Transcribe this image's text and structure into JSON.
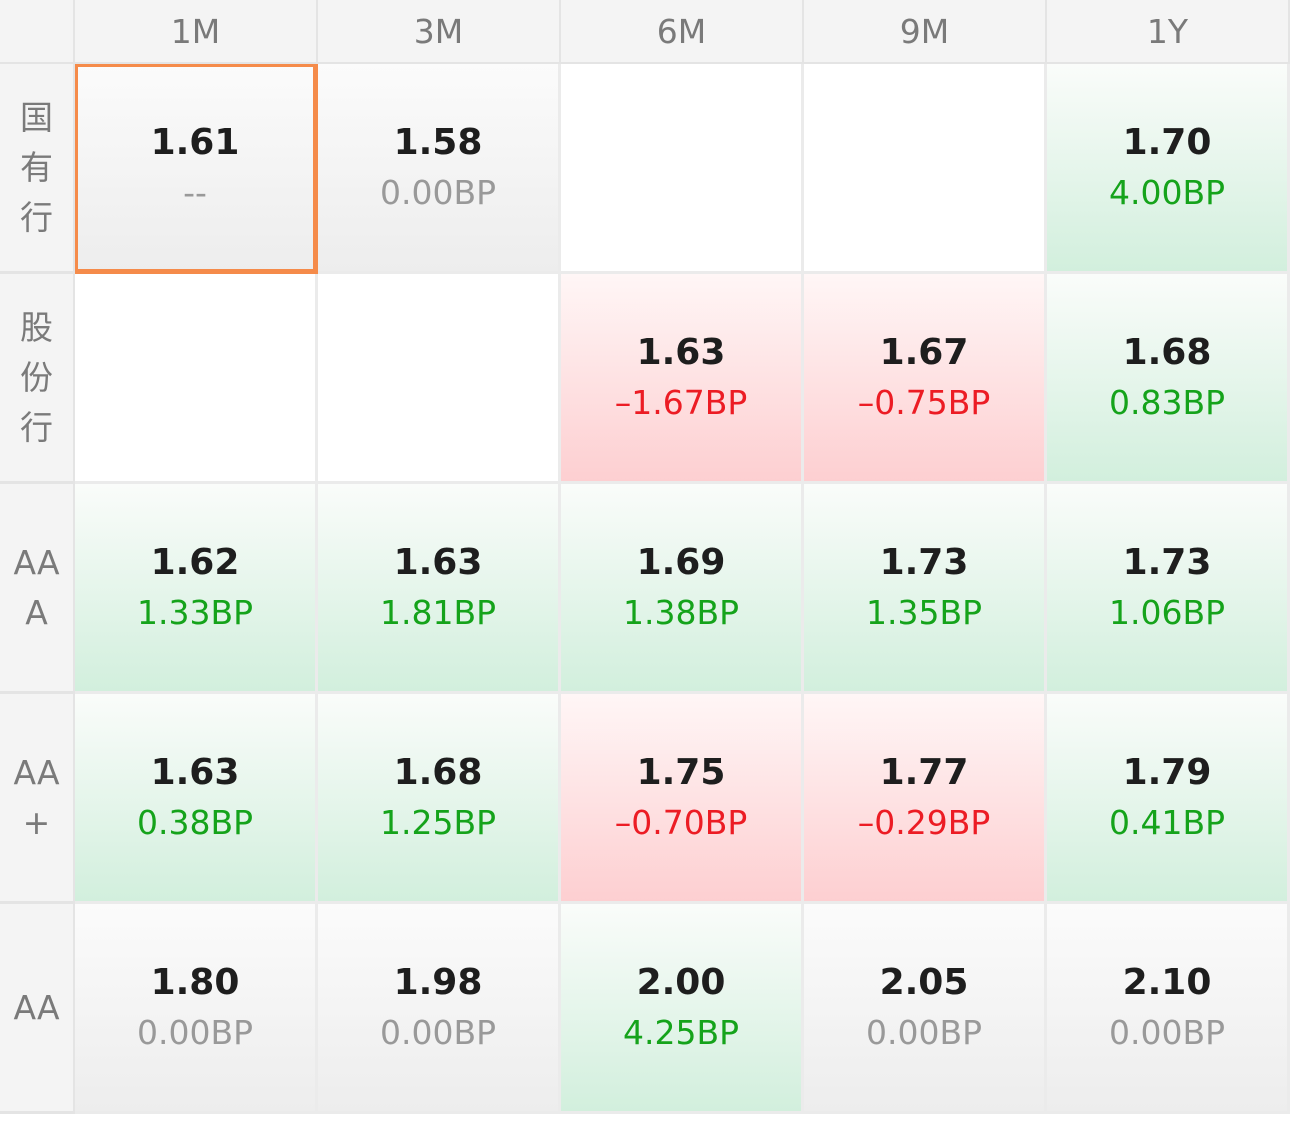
{
  "columns": [
    "1M",
    "3M",
    "6M",
    "9M",
    "1Y"
  ],
  "rows": [
    {
      "label": "国有行",
      "cells": [
        {
          "value": "1.61",
          "change": "--",
          "tone": "neutral",
          "selected": true
        },
        {
          "value": "1.58",
          "change": "0.00BP",
          "tone": "neutral"
        },
        {
          "value": "",
          "change": "",
          "tone": "empty"
        },
        {
          "value": "",
          "change": "",
          "tone": "empty"
        },
        {
          "value": "1.70",
          "change": "4.00BP",
          "tone": "green"
        }
      ]
    },
    {
      "label": "股份行",
      "cells": [
        {
          "value": "",
          "change": "",
          "tone": "empty"
        },
        {
          "value": "",
          "change": "",
          "tone": "empty"
        },
        {
          "value": "1.63",
          "change": "–1.67BP",
          "tone": "red"
        },
        {
          "value": "1.67",
          "change": "–0.75BP",
          "tone": "red"
        },
        {
          "value": "1.68",
          "change": "0.83BP",
          "tone": "green"
        }
      ]
    },
    {
      "label": "AAA",
      "cells": [
        {
          "value": "1.62",
          "change": "1.33BP",
          "tone": "green"
        },
        {
          "value": "1.63",
          "change": "1.81BP",
          "tone": "green"
        },
        {
          "value": "1.69",
          "change": "1.38BP",
          "tone": "green"
        },
        {
          "value": "1.73",
          "change": "1.35BP",
          "tone": "green"
        },
        {
          "value": "1.73",
          "change": "1.06BP",
          "tone": "green"
        }
      ]
    },
    {
      "label": "AA+",
      "cells": [
        {
          "value": "1.63",
          "change": "0.38BP",
          "tone": "green"
        },
        {
          "value": "1.68",
          "change": "1.25BP",
          "tone": "green"
        },
        {
          "value": "1.75",
          "change": "–0.70BP",
          "tone": "red"
        },
        {
          "value": "1.77",
          "change": "–0.29BP",
          "tone": "red"
        },
        {
          "value": "1.79",
          "change": "0.41BP",
          "tone": "green"
        }
      ]
    },
    {
      "label": "AA",
      "cells": [
        {
          "value": "1.80",
          "change": "0.00BP",
          "tone": "neutral"
        },
        {
          "value": "1.98",
          "change": "0.00BP",
          "tone": "neutral"
        },
        {
          "value": "2.00",
          "change": "4.25BP",
          "tone": "green"
        },
        {
          "value": "2.05",
          "change": "0.00BP",
          "tone": "neutral"
        },
        {
          "value": "2.10",
          "change": "0.00BP",
          "tone": "neutral"
        }
      ]
    }
  ],
  "colors": {
    "positive": "#15a31b",
    "negative": "#ec1c24",
    "neutral": "#999999",
    "selected_border": "#f58b4a",
    "value_text": "#1e1e1e",
    "header_text": "#7a7a7a"
  }
}
